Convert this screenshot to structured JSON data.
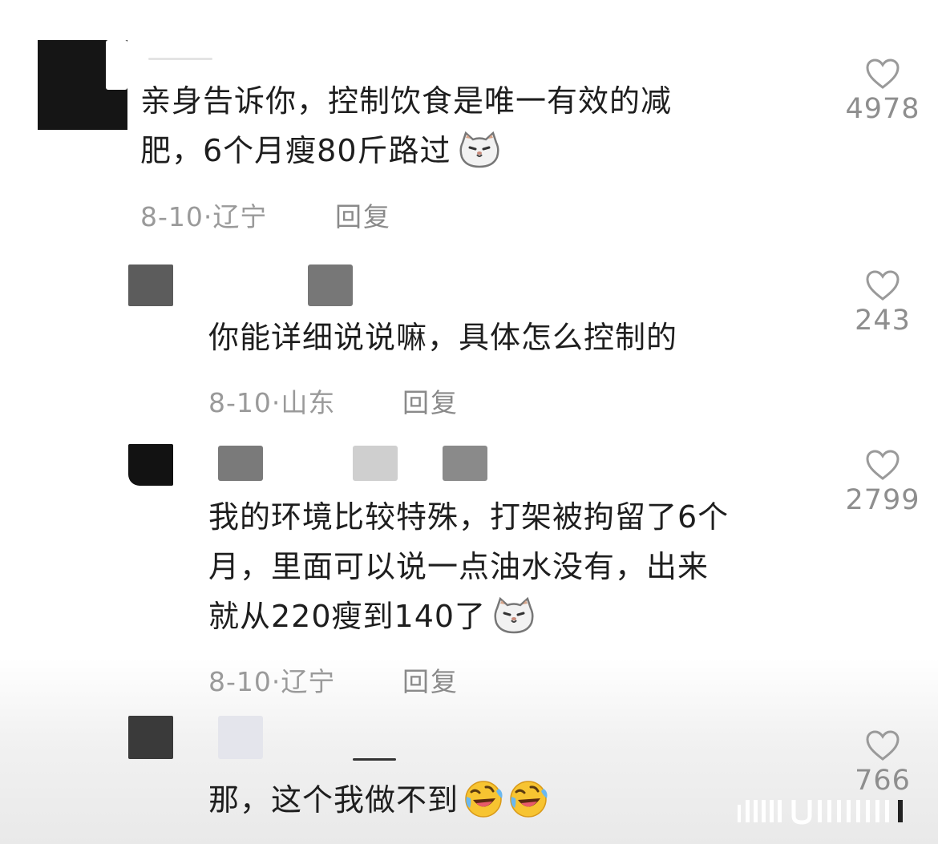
{
  "comments": [
    {
      "text_line1": "亲身告诉你，控制饮食是唯一有效的减",
      "text_line2": "肥，6个月瘦80斤路过",
      "date_location": "8-10·辽宁",
      "reply_label": "回复",
      "likes": "4978",
      "emoji": "cat-face-emoji"
    },
    {
      "text_line1": "你能详细说说嘛，具体怎么控制的",
      "date_location": "8-10·山东",
      "reply_label": "回复",
      "likes": "243"
    },
    {
      "text_line1": "我的环境比较特殊，打架被拘留了6个",
      "text_line2": "月，里面可以说一点油水没有，出来",
      "text_line3": "就从220瘦到140了",
      "date_location": "8-10·辽宁",
      "reply_label": "回复",
      "likes": "2799",
      "emoji": "cat-face-emoji"
    },
    {
      "text_line1": "那，这个我做不到",
      "likes": "766",
      "emoji": "rolling-laughing-emoji"
    }
  ],
  "colors": {
    "text": "#1e1e1e",
    "meta": "#9a9a9a",
    "heart_outline": "#9a9a9a",
    "emoji_yellow": "#f7c431"
  }
}
